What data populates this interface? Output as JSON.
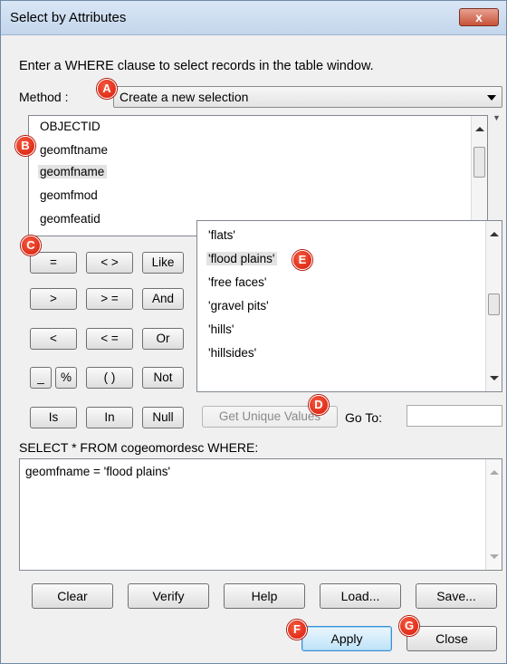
{
  "window": {
    "title": "Select by Attributes",
    "close_glyph": "x"
  },
  "instruction": "Enter a WHERE clause to select records in the table window.",
  "method": {
    "label": "Method :",
    "value": "Create a new selection"
  },
  "fields": {
    "items": [
      "OBJECTID",
      "geomftname",
      "geomfname",
      "geomfmod",
      "geomfeatid"
    ],
    "selected": "geomfname"
  },
  "operators": {
    "eq": "=",
    "ne": "< >",
    "like": "Like",
    "gt": ">",
    "ge": "> =",
    "and": "And",
    "lt": "<",
    "le": "< =",
    "or": "Or",
    "underscore": "_",
    "percent": "%",
    "parens": "( )",
    "not": "Not",
    "is": "Is",
    "in": "In",
    "null": "Null"
  },
  "values": {
    "items": [
      "'flats'",
      "'flood plains'",
      "'free faces'",
      "'gravel pits'",
      "'hills'",
      "'hillsides'"
    ],
    "selected": "'flood plains'"
  },
  "get_unique_values": "Get Unique Values",
  "goto": {
    "label": "Go To:",
    "value": ""
  },
  "sql": {
    "label": "SELECT * FROM cogeomordesc WHERE:",
    "expression": "geomfname = 'flood plains'"
  },
  "buttons": {
    "clear": "Clear",
    "verify": "Verify",
    "help": "Help",
    "load": "Load...",
    "save": "Save...",
    "apply": "Apply",
    "close": "Close"
  },
  "annotations": {
    "a": "A",
    "b": "B",
    "c": "C",
    "d": "D",
    "e": "E",
    "f": "F",
    "g": "G"
  },
  "colors": {
    "annotation_red": "#d81a0a",
    "titlebar": "#c4d6ec",
    "dialog_bg": "#f0f0f0"
  }
}
